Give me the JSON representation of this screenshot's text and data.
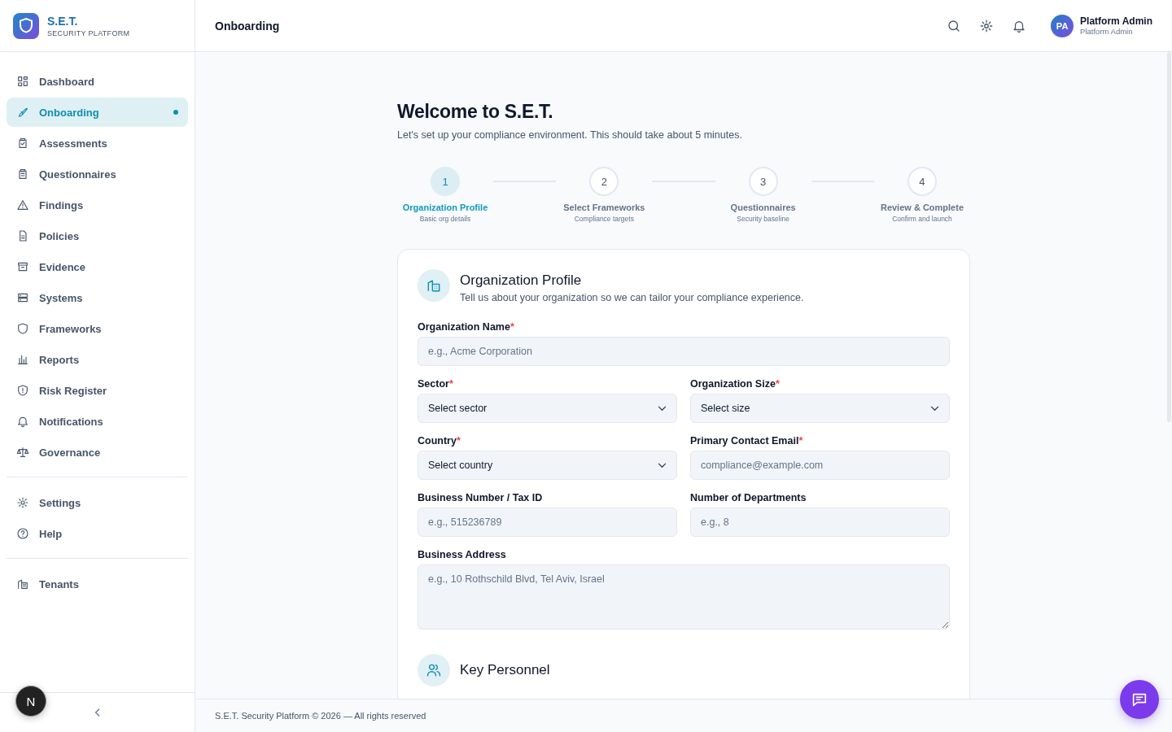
{
  "brand": {
    "name": "S.E.T.",
    "tagline": "SECURITY PLATFORM"
  },
  "sidebar": {
    "groups": [
      {
        "items": [
          {
            "label": "Dashboard",
            "selected": false,
            "dot": false
          },
          {
            "label": "Onboarding",
            "selected": true,
            "dot": true
          },
          {
            "label": "Assessments",
            "selected": false,
            "dot": false
          },
          {
            "label": "Questionnaires",
            "selected": false,
            "dot": false
          },
          {
            "label": "Findings",
            "selected": false,
            "dot": false
          },
          {
            "label": "Policies",
            "selected": false,
            "dot": false
          },
          {
            "label": "Evidence",
            "selected": false,
            "dot": false
          },
          {
            "label": "Systems",
            "selected": false,
            "dot": false
          },
          {
            "label": "Frameworks",
            "selected": false,
            "dot": false
          },
          {
            "label": "Reports",
            "selected": false,
            "dot": false
          },
          {
            "label": "Risk Register",
            "selected": false,
            "dot": false
          },
          {
            "label": "Notifications",
            "selected": false,
            "dot": false
          },
          {
            "label": "Governance",
            "selected": false,
            "dot": false
          }
        ]
      },
      {
        "items": [
          {
            "label": "Settings",
            "selected": false,
            "dot": false
          },
          {
            "label": "Help",
            "selected": false,
            "dot": false
          }
        ]
      },
      {
        "items": [
          {
            "label": "Tenants",
            "selected": false,
            "dot": false
          }
        ]
      }
    ],
    "dev_badge": "N"
  },
  "topbar": {
    "title": "Onboarding",
    "user": {
      "initials": "PA",
      "name": "Platform Admin",
      "role": "Platform Admin"
    }
  },
  "page": {
    "title": "Welcome to S.E.T.",
    "subtitle": "Let's set up your compliance environment. This should take about 5 minutes."
  },
  "steps": [
    {
      "number": "1",
      "title": "Organization Profile",
      "caption": "Basic org details",
      "selected": true
    },
    {
      "number": "2",
      "title": "Select Frameworks",
      "caption": "Compliance targets",
      "selected": false
    },
    {
      "number": "3",
      "title": "Questionnaires",
      "caption": "Security baseline",
      "selected": false
    },
    {
      "number": "4",
      "title": "Review & Complete",
      "caption": "Confirm and launch",
      "selected": false
    }
  ],
  "card": {
    "title": "Organization Profile",
    "description": "Tell us about your organization so we can tailor your compliance experience.",
    "fields": [
      {
        "kind": "text",
        "label": "Organization Name",
        "required_mark": "*",
        "placeholder": "e.g., Acme Corporation",
        "wide": true
      },
      {
        "kind": "select",
        "label": "Sector",
        "required_mark": "*",
        "value": "Select sector",
        "wide": false
      },
      {
        "kind": "select",
        "label": "Organization Size",
        "required_mark": "*",
        "value": "Select size",
        "wide": false
      },
      {
        "kind": "select",
        "label": "Country",
        "required_mark": "*",
        "value": "Select country",
        "wide": false
      },
      {
        "kind": "text",
        "label": "Primary Contact Email",
        "required_mark": "*",
        "placeholder": "compliance@example.com",
        "wide": false
      },
      {
        "kind": "text",
        "label": "Business Number / Tax ID",
        "placeholder": "e.g., 515236789",
        "wide": false
      },
      {
        "kind": "text",
        "label": "Number of Departments",
        "placeholder": "e.g., 8",
        "wide": false
      },
      {
        "kind": "textarea",
        "label": "Business Address",
        "placeholder": "e.g., 10 Rothschild Blvd, Tel Aviv, Israel",
        "wide": true
      }
    ],
    "next_section": {
      "title": "Key Personnel"
    }
  },
  "footer": {
    "text": "S.E.T. Security Platform © 2026 — All rights reserved"
  }
}
